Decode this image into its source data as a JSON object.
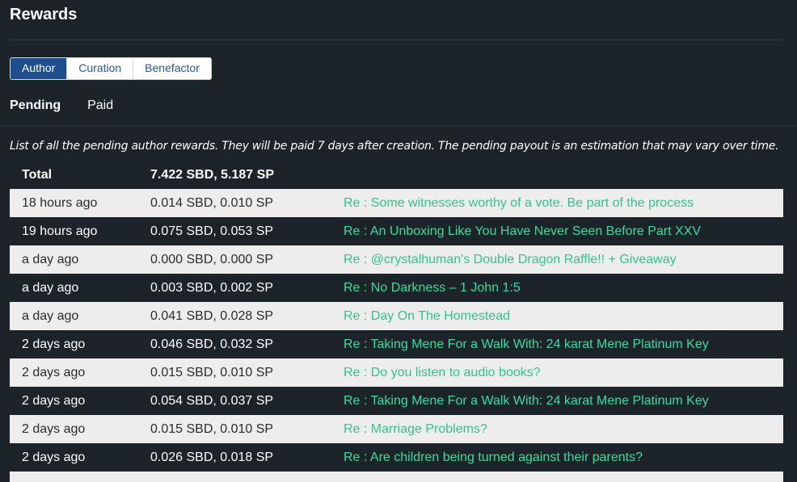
{
  "page": {
    "title": "Rewards",
    "tabs": [
      "Author",
      "Curation",
      "Benefactor"
    ],
    "active_tab": "Author",
    "subtabs": [
      "Pending",
      "Paid"
    ],
    "active_subtab": "Pending",
    "description": "List of all the pending author rewards. They will be paid 7 days after creation. The pending payout is an estimation that may vary over time."
  },
  "total": {
    "label": "Total",
    "value": "7.422 SBD, 5.187 SP"
  },
  "rows": [
    {
      "time": "18 hours ago",
      "amount": "0.014 SBD, 0.010 SP",
      "post": "Re : Some witnesses worthy of a vote. Be part of the process"
    },
    {
      "time": "19 hours ago",
      "amount": "0.075 SBD, 0.053 SP",
      "post": "Re : An Unboxing Like You Have Never Seen Before Part XXV"
    },
    {
      "time": "a day ago",
      "amount": "0.000 SBD, 0.000 SP",
      "post": "Re : @crystalhuman's Double Dragon Raffle!! + Giveaway"
    },
    {
      "time": "a day ago",
      "amount": "0.003 SBD, 0.002 SP",
      "post": "Re : No Darkness – 1 John 1:5"
    },
    {
      "time": "a day ago",
      "amount": "0.041 SBD, 0.028 SP",
      "post": "Re : Day On The Homestead"
    },
    {
      "time": "2 days ago",
      "amount": "0.046 SBD, 0.032 SP",
      "post": "Re : Taking Mene For a Walk With: 24 karat Mene Platinum Key"
    },
    {
      "time": "2 days ago",
      "amount": "0.015 SBD, 0.010 SP",
      "post": "Re : Do you listen to audio books?"
    },
    {
      "time": "2 days ago",
      "amount": "0.054 SBD, 0.037 SP",
      "post": "Re : Taking Mene For a Walk With: 24 karat Mene Platinum Key"
    },
    {
      "time": "2 days ago",
      "amount": "0.015 SBD, 0.010 SP",
      "post": "Re : Marriage Problems?"
    },
    {
      "time": "2 days ago",
      "amount": "0.026 SBD, 0.018 SP",
      "post": "Re : Are children being turned against their parents?"
    }
  ]
}
